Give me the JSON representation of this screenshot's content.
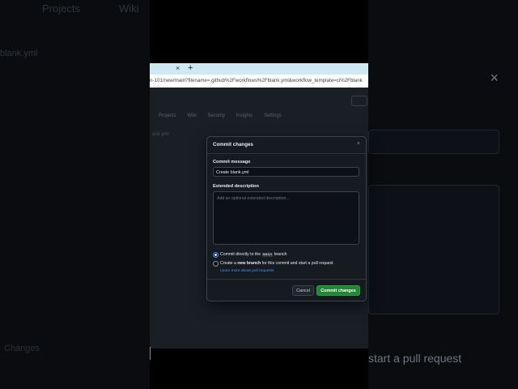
{
  "background": {
    "nav_items": [
      "Projects",
      "Wiki"
    ],
    "file_label": "blank.yml",
    "pr_text": "start a pull request",
    "changes_text": "Changes",
    "close_icon": "×"
  },
  "browser": {
    "tab_close": "×",
    "tab_plus": "+",
    "url": "n-101/new/main?filename=.github%2Fworkflows%2Fblank.yml&workflow_template=ci%2Fblank",
    "page_tabs": [
      "Projects",
      "Wiki",
      "Security",
      "Insights",
      "Settings"
    ],
    "page_file_label": "ank.yml"
  },
  "modal": {
    "title": "Commit changes",
    "close_icon": "×",
    "commit_message_label": "Commit message",
    "commit_message_value": "Create blank.yml",
    "extended_label": "Extended description",
    "extended_placeholder": "Add an optional extended description...",
    "option_direct_prefix": "Commit directly to the ",
    "option_direct_branch": "main",
    "option_direct_suffix": " branch",
    "option_new_prefix": "Create a ",
    "option_new_bold": "new branch",
    "option_new_suffix": " for this commit and start a pull request",
    "learn_more": "Learn more about pull requests",
    "cancel_label": "Cancel",
    "commit_label": "Commit changes",
    "selected_option": "direct"
  },
  "colors": {
    "accent_blue": "#4493f8",
    "commit_green": "#238636",
    "modal_bg": "#161b22"
  }
}
